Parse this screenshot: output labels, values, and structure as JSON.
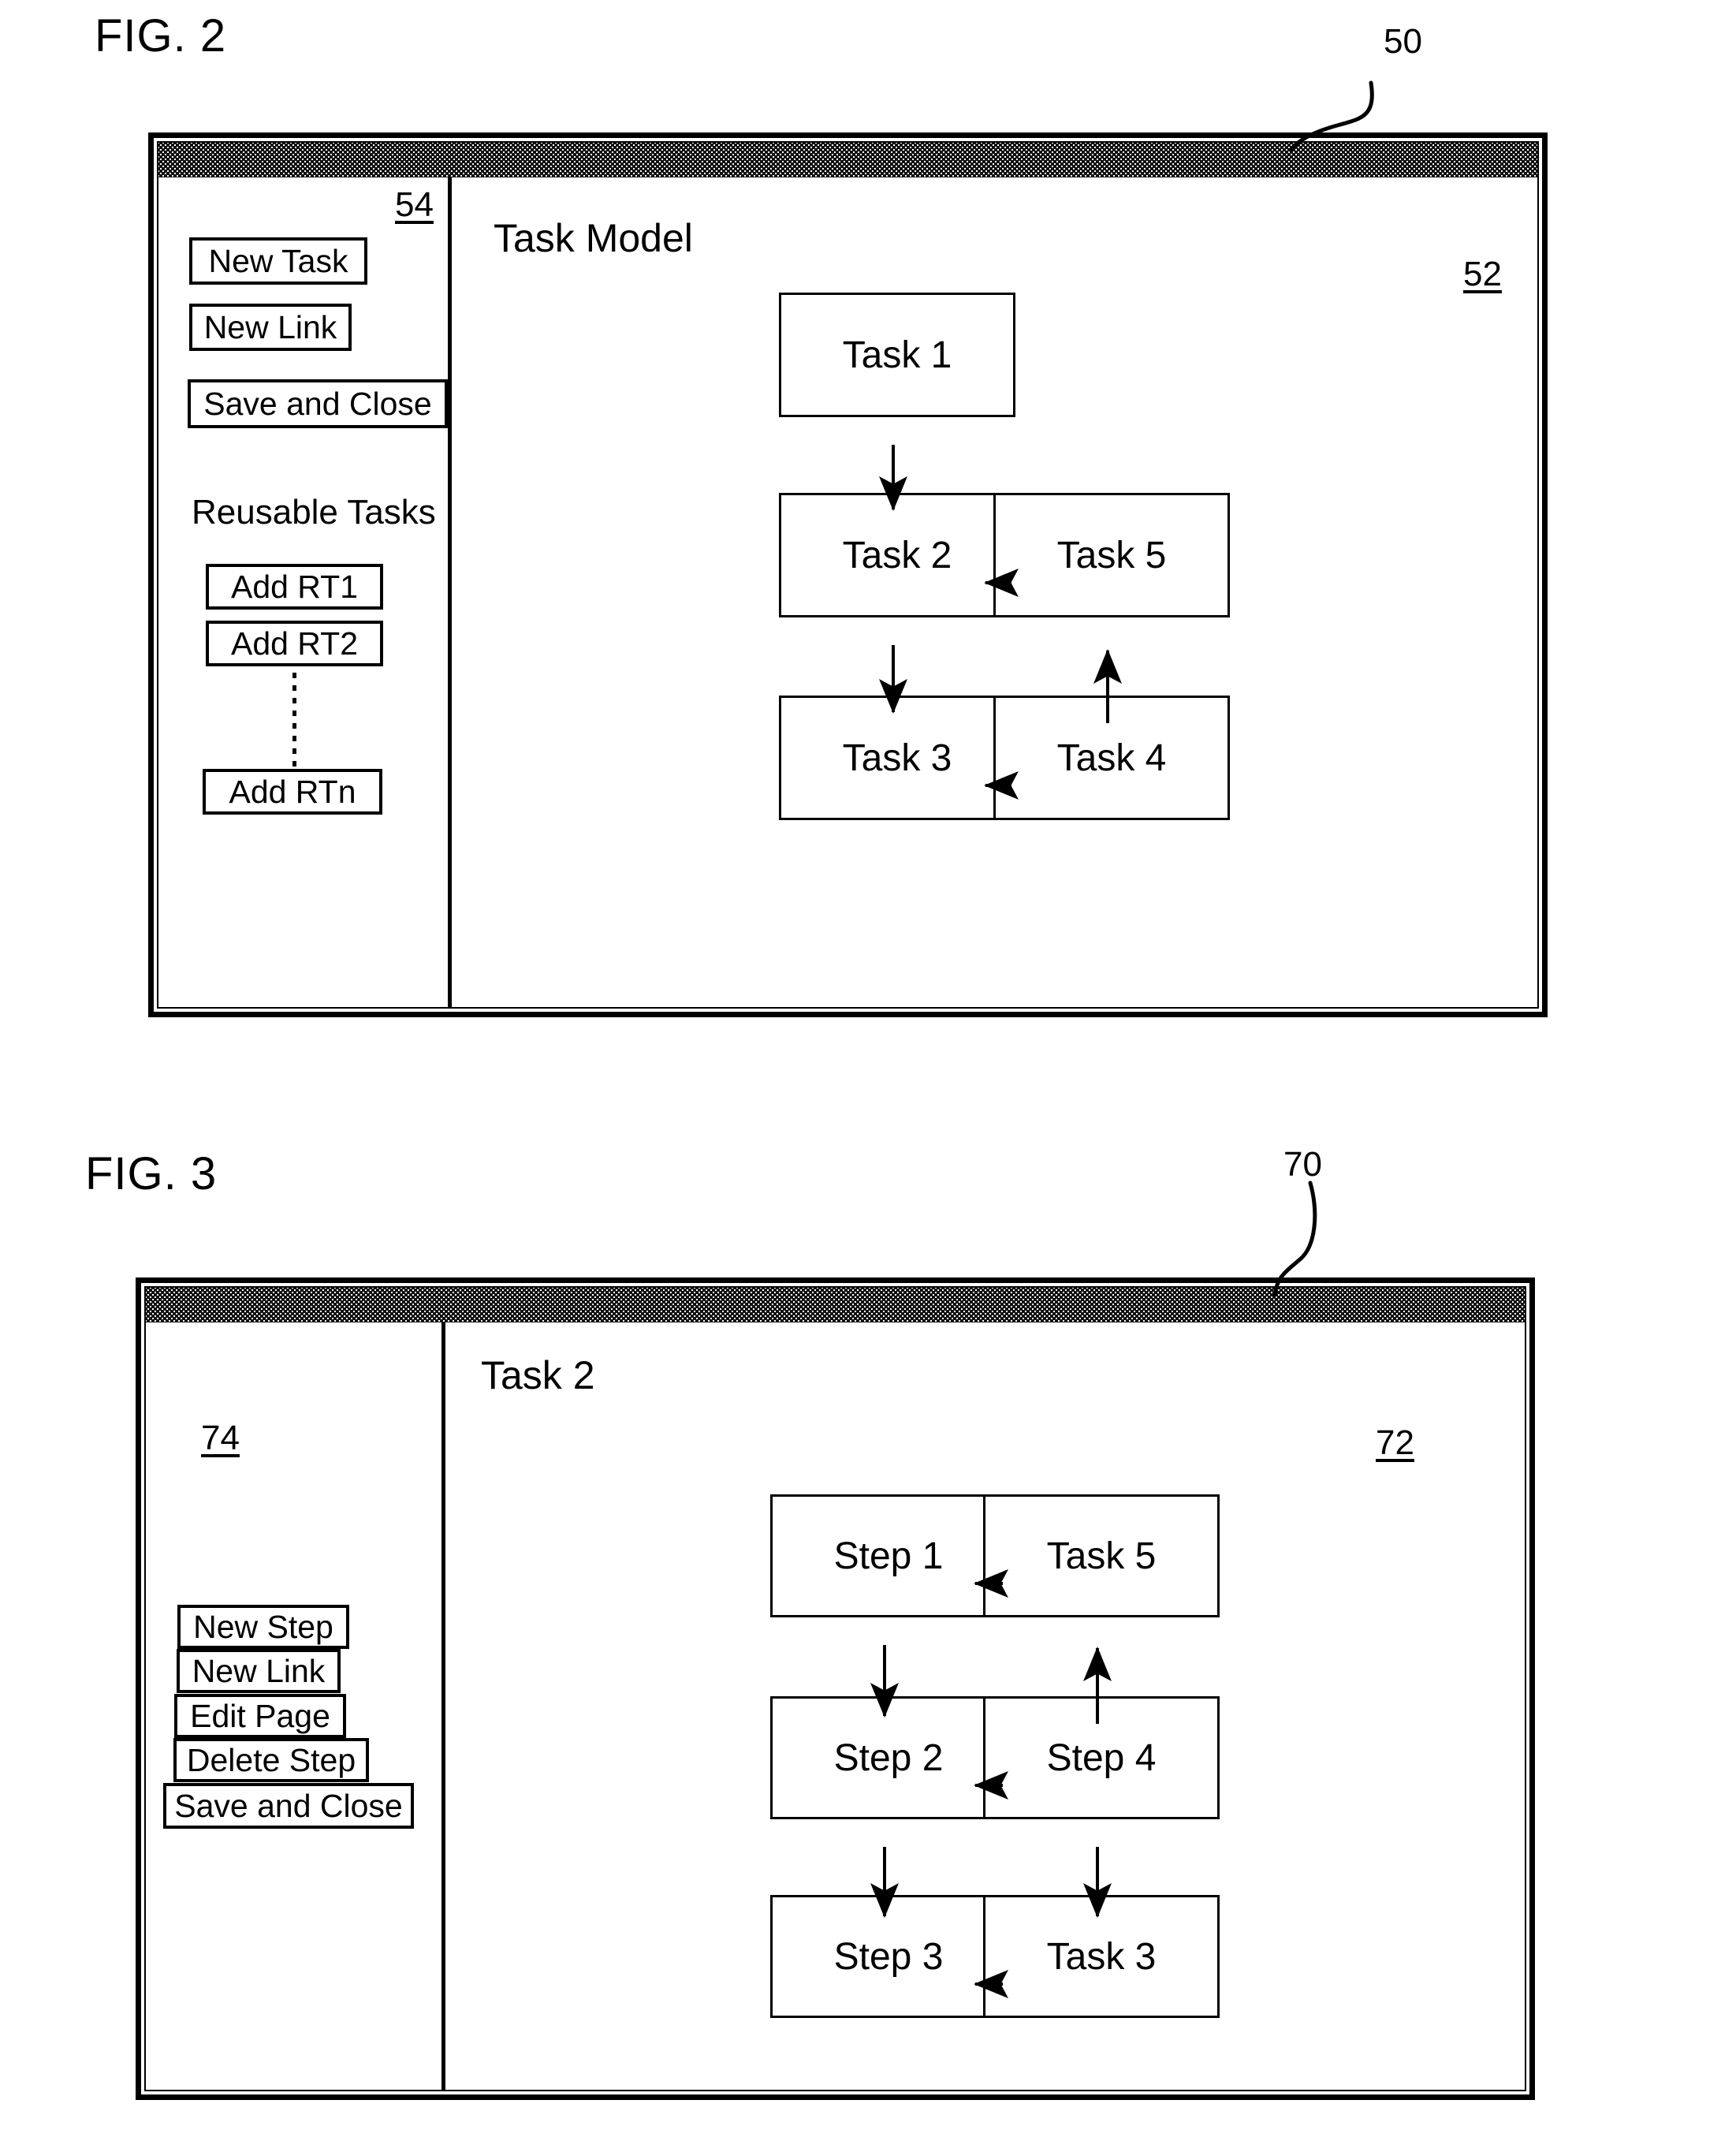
{
  "figures": [
    {
      "id": "fig2",
      "caption": "FIG. 2",
      "window_ref": "50",
      "sidebar_ref": "54",
      "content_ref": "52",
      "panel_title": "Task Model",
      "sidebar": {
        "buttons": [
          {
            "label": "New Task"
          },
          {
            "label": "New Link"
          },
          {
            "label": "Save and Close"
          }
        ],
        "section_heading": "Reusable Tasks",
        "reusable_buttons": [
          {
            "label": "Add RT1"
          },
          {
            "label": "Add RT2"
          },
          {
            "label": "Add RTn"
          }
        ],
        "ellipsis": "vertical-dots"
      },
      "diagram": {
        "type": "flowchart",
        "nodes": [
          {
            "id": "t1",
            "label": "Task 1"
          },
          {
            "id": "t2",
            "label": "Task 2"
          },
          {
            "id": "t5",
            "label": "Task 5"
          },
          {
            "id": "t3",
            "label": "Task 3"
          },
          {
            "id": "t4",
            "label": "Task 4"
          }
        ],
        "edges": [
          {
            "from": "t1",
            "to": "t2",
            "direction": "down"
          },
          {
            "from": "t2",
            "to": "t5",
            "direction": "right"
          },
          {
            "from": "t2",
            "to": "t3",
            "direction": "down"
          },
          {
            "from": "t3",
            "to": "t4",
            "direction": "right"
          },
          {
            "from": "t4",
            "to": "t5",
            "direction": "up"
          }
        ]
      }
    },
    {
      "id": "fig3",
      "caption": "FIG. 3",
      "window_ref": "70",
      "sidebar_ref": "74",
      "content_ref": "72",
      "panel_title": "Task 2",
      "sidebar": {
        "buttons": [
          {
            "label": "New Step"
          },
          {
            "label": "New Link"
          },
          {
            "label": "Edit Page"
          },
          {
            "label": "Delete Step"
          },
          {
            "label": "Save and Close"
          }
        ]
      },
      "diagram": {
        "type": "flowchart",
        "nodes": [
          {
            "id": "s1",
            "label": "Step 1"
          },
          {
            "id": "t5",
            "label": "Task 5"
          },
          {
            "id": "s2",
            "label": "Step 2"
          },
          {
            "id": "s4",
            "label": "Step 4"
          },
          {
            "id": "s3",
            "label": "Step 3"
          },
          {
            "id": "t3",
            "label": "Task 3"
          }
        ],
        "edges": [
          {
            "from": "s1",
            "to": "t5",
            "direction": "right"
          },
          {
            "from": "s1",
            "to": "s2",
            "direction": "down"
          },
          {
            "from": "s2",
            "to": "s4",
            "direction": "right"
          },
          {
            "from": "s2",
            "to": "s3",
            "direction": "down"
          },
          {
            "from": "s4",
            "to": "t5",
            "direction": "up"
          },
          {
            "from": "s4",
            "to": "t3",
            "direction": "down"
          },
          {
            "from": "s3",
            "to": "t3",
            "direction": "right"
          }
        ]
      }
    }
  ],
  "colors": {
    "ink": "#000000",
    "paper": "#ffffff",
    "titlebar": "#111111"
  }
}
